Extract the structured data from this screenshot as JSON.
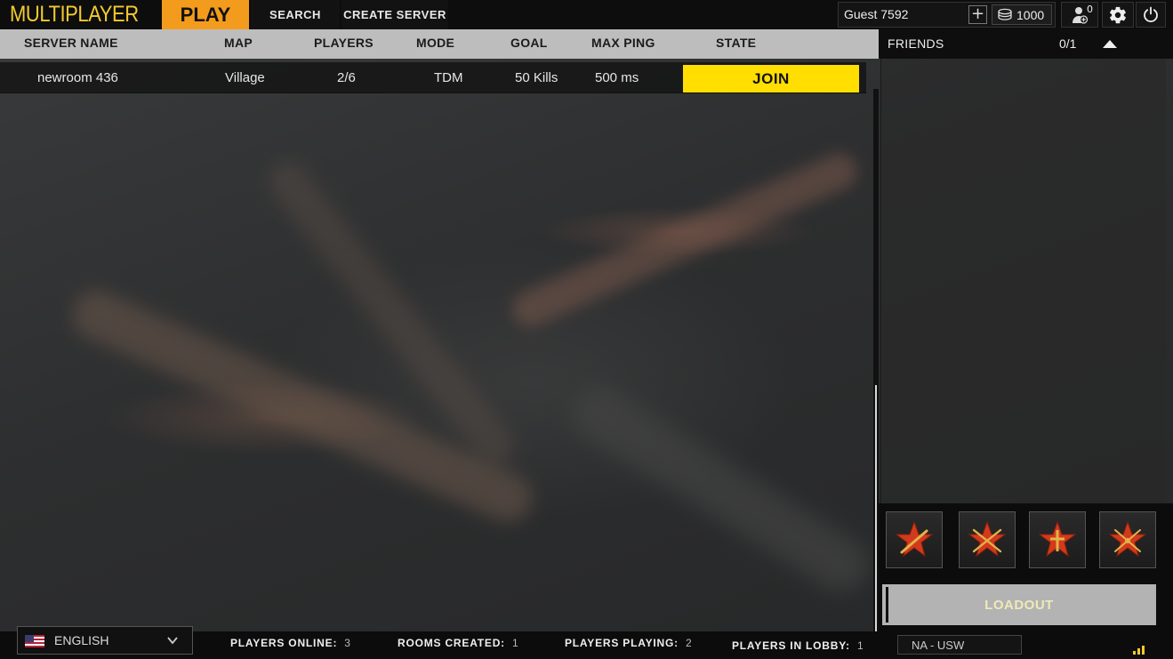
{
  "topbar": {
    "title": "MULTIPLAYER",
    "tabs": {
      "play": "PLAY",
      "search": "SEARCH",
      "create": "CREATE SERVER"
    },
    "user": {
      "name": "Guest 7592",
      "add_label": "+",
      "coins": "1000",
      "friend_requests": "0"
    }
  },
  "server_list": {
    "headers": [
      "SERVER NAME",
      "MAP",
      "PLAYERS",
      "MODE",
      "GOAL",
      "MAX PING",
      "STATE"
    ],
    "rows": [
      {
        "name": "newroom 436",
        "map": "Village",
        "players": "2/6",
        "mode": "TDM",
        "goal": "50 Kills",
        "ping": "500 ms",
        "state": "JOIN"
      }
    ]
  },
  "friends": {
    "title": "FRIENDS",
    "count": "0/1"
  },
  "classes": [
    "rifleman-class-icon",
    "sniper-class-icon",
    "medic-class-icon",
    "assault-class-icon"
  ],
  "loadout_label": "LOADOUT",
  "footer": {
    "language": "ENGLISH",
    "stats": {
      "online_label": "PLAYERS ONLINE:",
      "online": "3",
      "rooms_label": "ROOMS CREATED:",
      "rooms": "1",
      "playing_label": "PLAYERS PLAYING:",
      "playing": "2",
      "lobby_label": "PLAYERS IN LOBBY:",
      "lobby": "1"
    },
    "region": "NA - USW"
  },
  "colors": {
    "accent": "#f39b1d",
    "join": "#ffde00",
    "brand": "#f3ca2e",
    "star": "#d23a1c"
  }
}
